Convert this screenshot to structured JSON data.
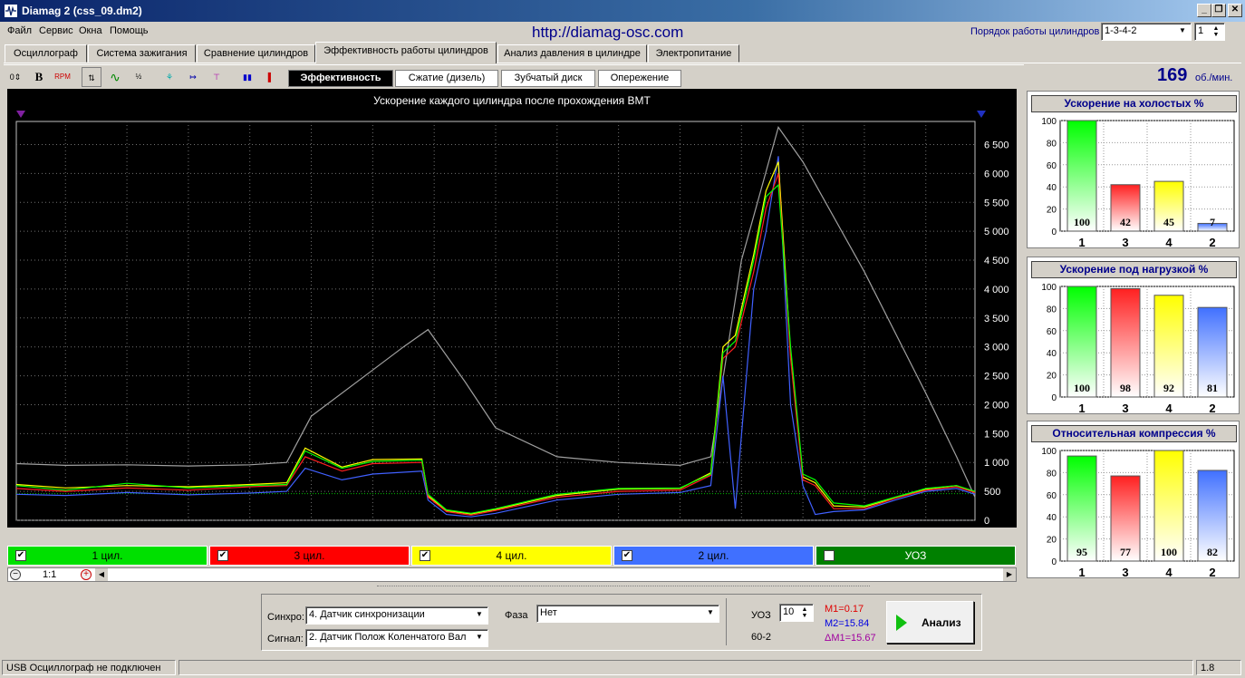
{
  "window": {
    "title": "Diamag 2 (css_09.dm2)"
  },
  "menu": [
    "Файл",
    "Сервис",
    "Окна",
    "Помощь"
  ],
  "site_url": "http://diamag-osc.com",
  "cyl_order": {
    "label": "Порядок работы цилиндров",
    "value": "1-3-4-2",
    "spin_value": "1"
  },
  "tabs": [
    "Осциллограф",
    "Система зажигания",
    "Сравнение цилиндров",
    "Эффективность работы цилиндров",
    "Анализ давления в цилиндре",
    "Электропитание"
  ],
  "active_tab": "Эффективность работы цилиндров",
  "subtabs": [
    "Эффективность",
    "Сжатие (дизель)",
    "Зубчатый диск",
    "Опережение"
  ],
  "rpm": {
    "value": "169",
    "unit": "об./мин."
  },
  "chart_data": {
    "type": "line",
    "title": "Ускорение каждого цилиндра после прохождения ВМТ",
    "x_ticks": [
      "1",
      "2",
      "3",
      "4",
      "5",
      "6",
      "7",
      "8",
      "9",
      "10",
      "11",
      "12",
      "13",
      "14",
      "15"
    ],
    "y_ticks": [
      "0",
      "500",
      "1 000",
      "1 500",
      "2 000",
      "2 500",
      "3 000",
      "3 500",
      "4 000",
      "4 500",
      "5 000",
      "5 500",
      "6 000",
      "6 500"
    ],
    "xlim": [
      0.2,
      15.8
    ],
    "ylim": [
      0,
      6900
    ],
    "grid": true,
    "series": [
      {
        "name": "1 цил.",
        "color": "#00ff00",
        "x": [
          0.2,
          1,
          2,
          3,
          4,
          4.6,
          4.9,
          5.5,
          6,
          6.8,
          6.9,
          7.2,
          7.6,
          8,
          9,
          10,
          11,
          11.5,
          11.7,
          11.9,
          12.2,
          12.4,
          12.6,
          12.8,
          13,
          13.2,
          13.5,
          14,
          14.5,
          15,
          15.5,
          15.8
        ],
        "y": [
          600,
          520,
          640,
          560,
          600,
          620,
          1200,
          900,
          1020,
          1040,
          450,
          180,
          120,
          200,
          450,
          550,
          560,
          800,
          2900,
          3100,
          4500,
          5600,
          5800,
          3000,
          800,
          700,
          300,
          250,
          400,
          550,
          600,
          500
        ]
      },
      {
        "name": "3 цил.",
        "color": "#ff2020",
        "x": [
          0.2,
          1,
          2,
          3,
          4,
          4.6,
          4.9,
          5.5,
          6,
          6.8,
          6.9,
          7.2,
          7.6,
          8,
          9,
          10,
          11,
          11.5,
          11.7,
          11.9,
          12.2,
          12.4,
          12.6,
          12.8,
          13,
          13.2,
          13.5,
          14,
          14.5,
          15,
          15.5,
          15.8
        ],
        "y": [
          550,
          500,
          560,
          520,
          580,
          600,
          1100,
          850,
          980,
          1000,
          400,
          150,
          90,
          170,
          400,
          500,
          520,
          780,
          2800,
          3000,
          4300,
          5400,
          6000,
          2800,
          700,
          600,
          200,
          200,
          380,
          520,
          580,
          480
        ]
      },
      {
        "name": "4 цил.",
        "color": "#ffff00",
        "x": [
          0.2,
          1,
          2,
          3,
          4,
          4.6,
          4.9,
          5.5,
          6,
          6.8,
          6.9,
          7.2,
          7.6,
          8,
          9,
          10,
          11,
          11.5,
          11.7,
          11.9,
          12.2,
          12.4,
          12.6,
          12.8,
          13,
          13.2,
          13.5,
          14,
          14.5,
          15,
          15.5,
          15.8
        ],
        "y": [
          620,
          560,
          600,
          580,
          620,
          650,
          1250,
          920,
          1050,
          1060,
          420,
          170,
          110,
          190,
          430,
          540,
          550,
          820,
          3000,
          3200,
          4600,
          5700,
          6200,
          2900,
          750,
          650,
          250,
          230,
          390,
          540,
          600,
          490
        ]
      },
      {
        "name": "2 цил.",
        "color": "#4060ff",
        "x": [
          0.2,
          1,
          2,
          3,
          4,
          4.6,
          4.9,
          5.5,
          6,
          6.8,
          6.9,
          7.2,
          7.6,
          8,
          9,
          10,
          11,
          11.5,
          11.7,
          11.9,
          12.2,
          12.4,
          12.6,
          12.8,
          13,
          13.2,
          13.5,
          14,
          14.5,
          15,
          15.5,
          15.8
        ],
        "y": [
          450,
          430,
          480,
          440,
          470,
          500,
          900,
          700,
          800,
          850,
          350,
          100,
          60,
          120,
          350,
          450,
          480,
          600,
          2500,
          200,
          4000,
          5000,
          6300,
          2000,
          600,
          100,
          150,
          180,
          350,
          500,
          550,
          450
        ]
      },
      {
        "name": "УОЗ",
        "color": "#a0a0a0",
        "x": [
          0.2,
          1,
          2,
          3,
          4,
          4.6,
          5,
          6,
          6.5,
          6.9,
          7.5,
          8,
          9,
          10,
          11,
          11.5,
          12,
          12.6,
          13,
          14,
          15,
          15.5,
          15.8
        ],
        "y": [
          980,
          950,
          960,
          940,
          960,
          1000,
          1800,
          2600,
          3000,
          3300,
          2400,
          1600,
          1100,
          1000,
          950,
          1100,
          4500,
          6800,
          6200,
          4300,
          2200,
          1100,
          400
        ]
      }
    ]
  },
  "legend": [
    {
      "label": "1 цил.",
      "checked": true,
      "color": "#00e000"
    },
    {
      "label": "3 цил.",
      "checked": true,
      "color": "#ff0000"
    },
    {
      "label": "4 цил.",
      "checked": true,
      "color": "#ffff00"
    },
    {
      "label": "2 цил.",
      "checked": true,
      "color": "#4070ff"
    },
    {
      "label": "УОЗ",
      "checked": false,
      "color": "#008000"
    }
  ],
  "zoom": {
    "label": "1:1"
  },
  "panels": [
    {
      "title": "Ускорение на холостых %",
      "categories": [
        "1",
        "3",
        "4",
        "2"
      ],
      "values": [
        100,
        42,
        45,
        7
      ],
      "y_ticks": [
        "0",
        "20",
        "40",
        "60",
        "80",
        "100"
      ]
    },
    {
      "title": "Ускорение под нагрузкой %",
      "categories": [
        "1",
        "3",
        "4",
        "2"
      ],
      "values": [
        100,
        98,
        92,
        81
      ],
      "y_ticks": [
        "0",
        "20",
        "40",
        "60",
        "80",
        "100"
      ]
    },
    {
      "title": "Относительная компрессия %",
      "categories": [
        "1",
        "3",
        "4",
        "2"
      ],
      "values": [
        95,
        77,
        100,
        82
      ],
      "y_ticks": [
        "0",
        "20",
        "40",
        "60",
        "80",
        "100"
      ]
    }
  ],
  "bar_colors": [
    "#00ff00",
    "#ff2020",
    "#ffff00",
    "#4070ff"
  ],
  "controls": {
    "sync_label": "Синхро:",
    "sync_value": "4. Датчик синхронизации",
    "signal_label": "Сигнал:",
    "signal_value": "2. Датчик Полож Коленчатого Вал",
    "phase_label": "Фаза",
    "phase_value": "Нет",
    "uoz_label": "УОЗ",
    "uoz_value": "10",
    "teeth": "60-2",
    "m1": "M1=0.17",
    "m2": "M2=15.84",
    "dm1": "ΔM1=15.67",
    "analysis_label": "Анализ"
  },
  "status": {
    "left": "USB Осциллограф не подключен",
    "right": "1.8"
  }
}
